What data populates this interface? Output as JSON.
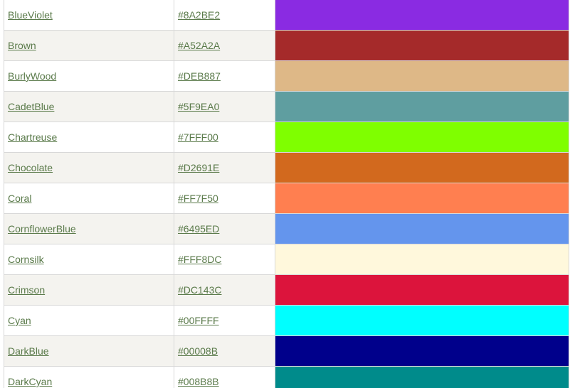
{
  "colors": [
    {
      "name": "BlueViolet",
      "hex": "#8A2BE2"
    },
    {
      "name": "Brown",
      "hex": "#A52A2A"
    },
    {
      "name": "BurlyWood",
      "hex": "#DEB887"
    },
    {
      "name": "CadetBlue",
      "hex": "#5F9EA0"
    },
    {
      "name": "Chartreuse",
      "hex": "#7FFF00"
    },
    {
      "name": "Chocolate",
      "hex": "#D2691E"
    },
    {
      "name": "Coral",
      "hex": "#FF7F50"
    },
    {
      "name": "CornflowerBlue",
      "hex": "#6495ED"
    },
    {
      "name": "Cornsilk",
      "hex": "#FFF8DC"
    },
    {
      "name": "Crimson",
      "hex": "#DC143C"
    },
    {
      "name": "Cyan",
      "hex": "#00FFFF"
    },
    {
      "name": "DarkBlue",
      "hex": "#00008B"
    },
    {
      "name": "DarkCyan",
      "hex": "#008B8B"
    }
  ]
}
